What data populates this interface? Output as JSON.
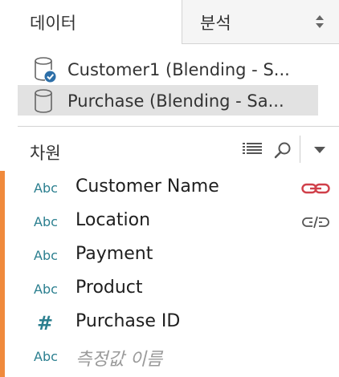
{
  "tabs": {
    "data_label": "데이터",
    "analysis_label": "분석"
  },
  "data_sources": [
    {
      "label": "Customer1 (Blending - S...",
      "icon": "database-check-icon",
      "selected": false
    },
    {
      "label": "Purchase (Blending - Sa...",
      "icon": "database-icon",
      "selected": true
    }
  ],
  "dimensions": {
    "title": "차원"
  },
  "fields": [
    {
      "type": "Abc",
      "name": "Customer Name",
      "link": "linked-active"
    },
    {
      "type": "Abc",
      "name": "Location",
      "link": "linked-broken"
    },
    {
      "type": "Abc",
      "name": "Payment",
      "link": ""
    },
    {
      "type": "Abc",
      "name": "Product",
      "link": ""
    },
    {
      "type": "#",
      "name": "Purchase ID",
      "link": ""
    },
    {
      "type": "Abc",
      "name": "측정값 이름",
      "link": ""
    }
  ],
  "colors": {
    "accent": "#f08a3c",
    "type_icon": "#2b7f8f",
    "link_active": "#d0404a",
    "link_inactive": "#555555",
    "check_badge": "#2d6fa8"
  }
}
